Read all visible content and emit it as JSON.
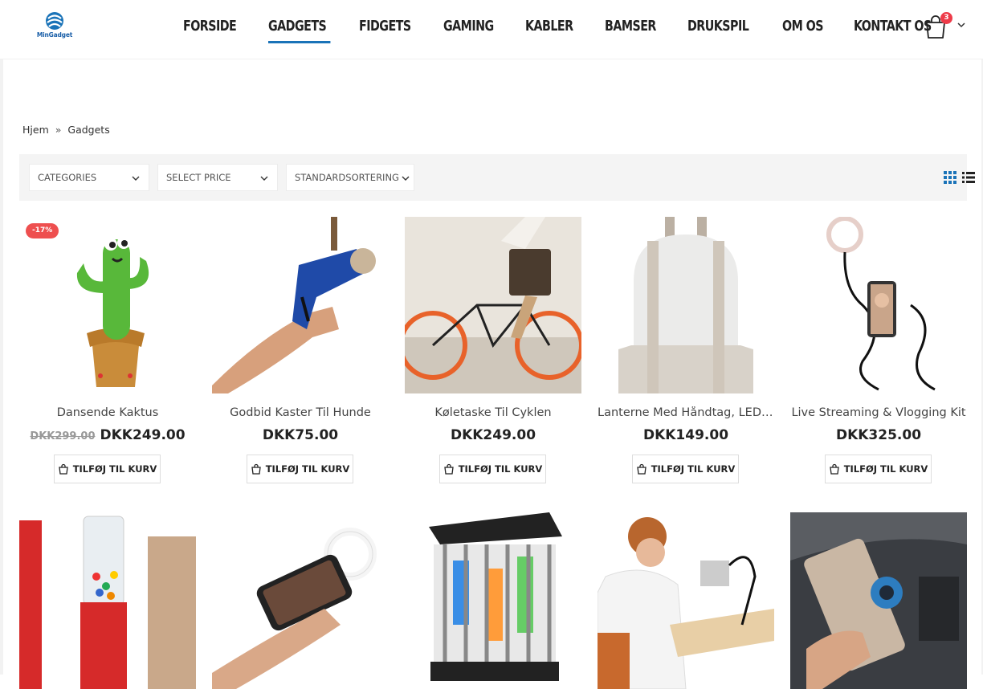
{
  "brand": {
    "logo_text": "MinGadget",
    "accent": "#1a73b8"
  },
  "nav": {
    "items": [
      {
        "label": "FORSIDE",
        "active": false
      },
      {
        "label": "GADGETS",
        "active": true
      },
      {
        "label": "FIDGETS",
        "active": false
      },
      {
        "label": "GAMING",
        "active": false
      },
      {
        "label": "KABLER",
        "active": false
      },
      {
        "label": "BAMSER",
        "active": false
      },
      {
        "label": "DRUKSPIL",
        "active": false
      },
      {
        "label": "OM OS",
        "active": false
      },
      {
        "label": "KONTAKT OS",
        "active": false
      }
    ]
  },
  "cart": {
    "count": "3",
    "icon": "shopping-bag-icon"
  },
  "breadcrumb": {
    "home": "Hjem",
    "separator": "»",
    "current": "Gadgets"
  },
  "filters": {
    "categories": "CATEGORIES",
    "price": "SELECT PRICE",
    "sort": "STANDARDSORTERING"
  },
  "products": [
    {
      "name": "Dansende Kaktus",
      "old_price": "DKK299.00",
      "price": "DKK249.00",
      "badge": "-17%",
      "button": "TILFØJ TIL KURV"
    },
    {
      "name": "Godbid Kaster Til Hunde",
      "price": "DKK75.00",
      "button": "TILFØJ TIL KURV"
    },
    {
      "name": "Køletaske Til Cyklen",
      "price": "DKK249.00",
      "button": "TILFØJ TIL KURV"
    },
    {
      "name": "Lanterne Med Håndtag, LED Lys",
      "price": "DKK149.00",
      "button": "TILFØJ TIL KURV"
    },
    {
      "name": "Live Streaming & Vlogging Kit",
      "price": "DKK325.00",
      "button": "TILFØJ TIL KURV"
    }
  ]
}
